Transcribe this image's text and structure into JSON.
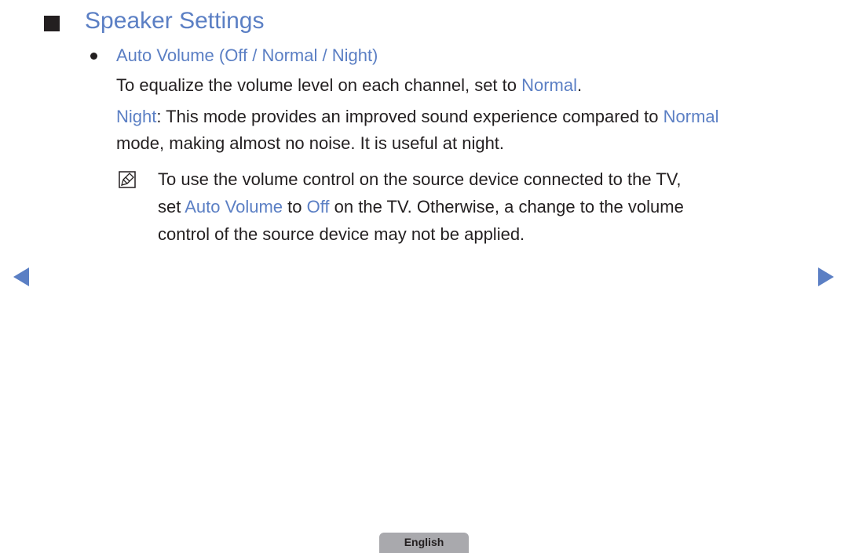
{
  "page": {
    "title": "Speaker Settings",
    "section": {
      "heading": "Auto Volume (Off / Normal / Night)",
      "para1": {
        "text": "To equalize the volume level on each channel, set to ",
        "highlight": "Normal",
        "end": "."
      },
      "para2": {
        "highlight1": "Night",
        "line1_rest": ": This mode provides an improved sound experience compared to ",
        "highlight2": "Normal",
        "line2": "mode, making almost no noise. It is useful at night."
      },
      "note": {
        "line1": "To use the volume control on the source device connected to the TV,",
        "line2_a": "set ",
        "line2_hl1": "Auto Volume",
        "line2_b": " to ",
        "line2_hl2": "Off",
        "line2_c": " on the TV. Otherwise, a change to the volume",
        "line3": "control of the source device may not be applied."
      }
    }
  },
  "navigation": {
    "prev_icon": "triangle-left",
    "next_icon": "triangle-right"
  },
  "footer": {
    "language": "English"
  },
  "colors": {
    "accent": "#5b7fc4",
    "text": "#231f20",
    "language_tab": "#a9a9ad"
  }
}
